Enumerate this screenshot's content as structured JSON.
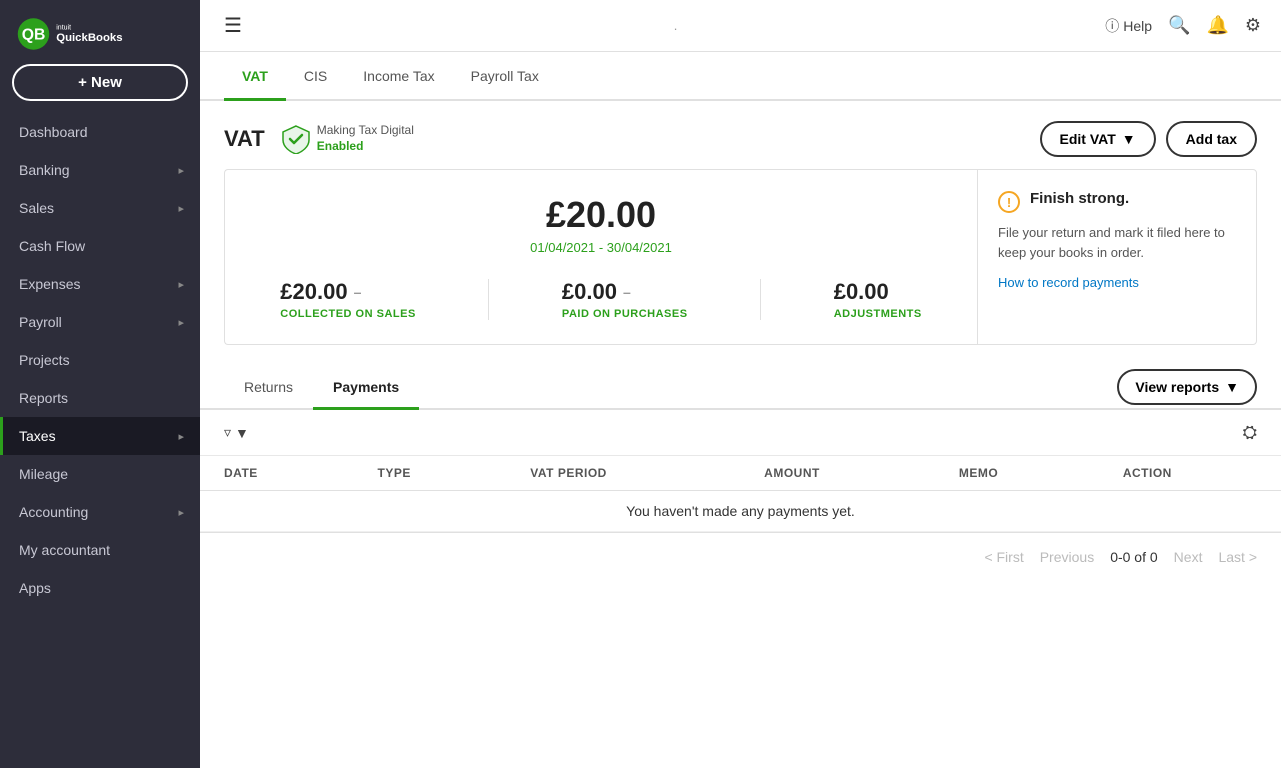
{
  "sidebar": {
    "logo_alt": "QuickBooks",
    "new_button": "+ New",
    "items": [
      {
        "id": "dashboard",
        "label": "Dashboard",
        "has_chevron": false,
        "active": false
      },
      {
        "id": "banking",
        "label": "Banking",
        "has_chevron": true,
        "active": false
      },
      {
        "id": "sales",
        "label": "Sales",
        "has_chevron": true,
        "active": false
      },
      {
        "id": "cashflow",
        "label": "Cash Flow",
        "has_chevron": false,
        "active": false
      },
      {
        "id": "expenses",
        "label": "Expenses",
        "has_chevron": true,
        "active": false
      },
      {
        "id": "payroll",
        "label": "Payroll",
        "has_chevron": true,
        "active": false
      },
      {
        "id": "projects",
        "label": "Projects",
        "has_chevron": false,
        "active": false
      },
      {
        "id": "reports",
        "label": "Reports",
        "has_chevron": false,
        "active": false
      },
      {
        "id": "taxes",
        "label": "Taxes",
        "has_chevron": true,
        "active": true
      },
      {
        "id": "mileage",
        "label": "Mileage",
        "has_chevron": false,
        "active": false
      },
      {
        "id": "accounting",
        "label": "Accounting",
        "has_chevron": true,
        "active": false
      },
      {
        "id": "myaccountant",
        "label": "My accountant",
        "has_chevron": false,
        "active": false
      },
      {
        "id": "apps",
        "label": "Apps",
        "has_chevron": false,
        "active": false
      }
    ]
  },
  "topbar": {
    "center_text": ".",
    "help_label": "Help"
  },
  "tabs": [
    {
      "id": "vat",
      "label": "VAT",
      "active": true
    },
    {
      "id": "cis",
      "label": "CIS",
      "active": false
    },
    {
      "id": "income_tax",
      "label": "Income Tax",
      "active": false
    },
    {
      "id": "payroll_tax",
      "label": "Payroll Tax",
      "active": false
    }
  ],
  "vat": {
    "title": "VAT",
    "mtd_label": "Making Tax Digital",
    "mtd_enabled": "Enabled",
    "edit_vat_label": "Edit VAT",
    "add_tax_label": "Add tax",
    "amount": "£20.00",
    "period": "01/04/2021 - 30/04/2021",
    "collected_amount": "£20.00",
    "collected_label": "COLLECTED ON SALES",
    "paid_amount": "£0.00",
    "paid_label": "PAID ON PURCHASES",
    "adjustments_amount": "£0.00",
    "adjustments_label": "ADJUSTMENTS",
    "info_title": "Finish strong.",
    "info_body": "File your return and mark it filed here to keep your books in order.",
    "info_link": "How to record payments"
  },
  "sub_tabs": [
    {
      "id": "returns",
      "label": "Returns",
      "active": false
    },
    {
      "id": "payments",
      "label": "Payments",
      "active": true
    }
  ],
  "view_reports_label": "View reports",
  "table": {
    "headers": [
      "DATE",
      "TYPE",
      "VAT PERIOD",
      "AMOUNT",
      "MEMO",
      "ACTION"
    ],
    "empty_message": "You haven't made any payments yet."
  },
  "pagination": {
    "first": "< First",
    "previous": "Previous",
    "range": "0-0 of 0",
    "next": "Next",
    "last": "Last >"
  }
}
